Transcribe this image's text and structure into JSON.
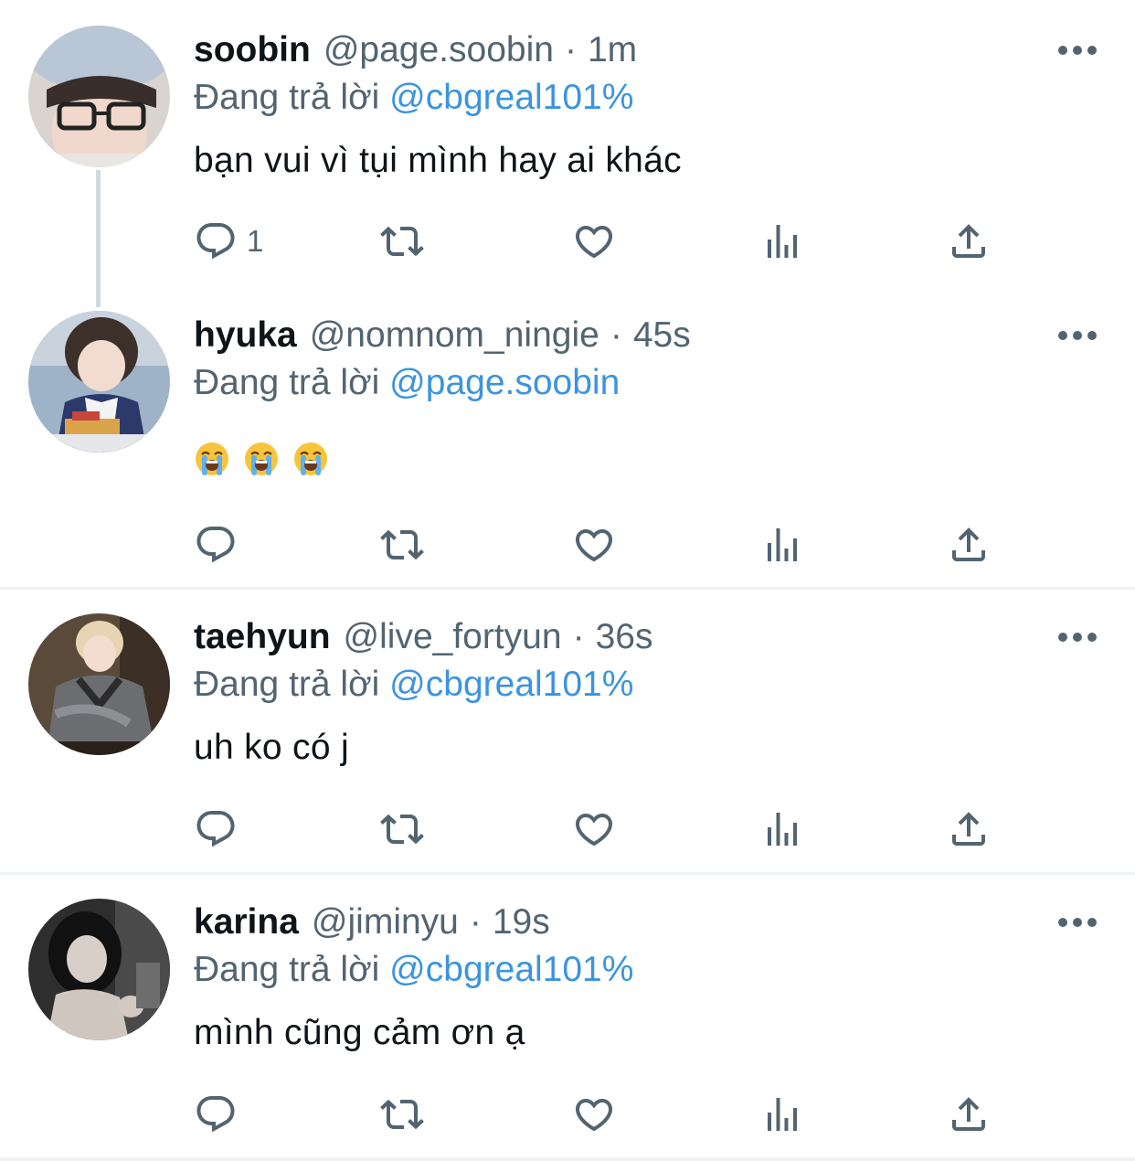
{
  "tweets": [
    {
      "name": "soobin",
      "handle": "@page.soobin",
      "separator": "·",
      "time": "1m",
      "reply_prefix": "Đang trả lời",
      "reply_mention": "@cbgreal101%",
      "text": "bạn vui vì tụi mình hay ai khác",
      "reply_count": "1"
    },
    {
      "name": "hyuka",
      "handle": "@nomnom_ningie",
      "separator": "·",
      "time": "45s",
      "reply_prefix": "Đang trả lời",
      "reply_mention": "@page.soobin",
      "text": "😭😭😭",
      "emoji": [
        "loudly-crying-face",
        "loudly-crying-face",
        "loudly-crying-face"
      ],
      "reply_count": ""
    },
    {
      "name": "taehyun",
      "handle": "@live_fortyun",
      "separator": "·",
      "time": "36s",
      "reply_prefix": "Đang trả lời",
      "reply_mention": "@cbgreal101%",
      "text": "uh ko có j",
      "reply_count": ""
    },
    {
      "name": "karina",
      "handle": "@jiminyu",
      "separator": "·",
      "time": "19s",
      "reply_prefix": "Đang trả lời",
      "reply_mention": "@cbgreal101%",
      "text": "mình cũng cảm ơn ạ",
      "reply_count": ""
    }
  ],
  "icons": {
    "reply": "reply-icon",
    "retweet": "retweet-icon",
    "like": "heart-icon",
    "views": "analytics-icon",
    "share": "share-icon",
    "more": "more-icon"
  },
  "colors": {
    "text_primary": "#0f1419",
    "text_secondary": "#536471",
    "mention": "#3b94e0",
    "divider": "#eff3f4",
    "thread_line": "#cfd9de"
  }
}
